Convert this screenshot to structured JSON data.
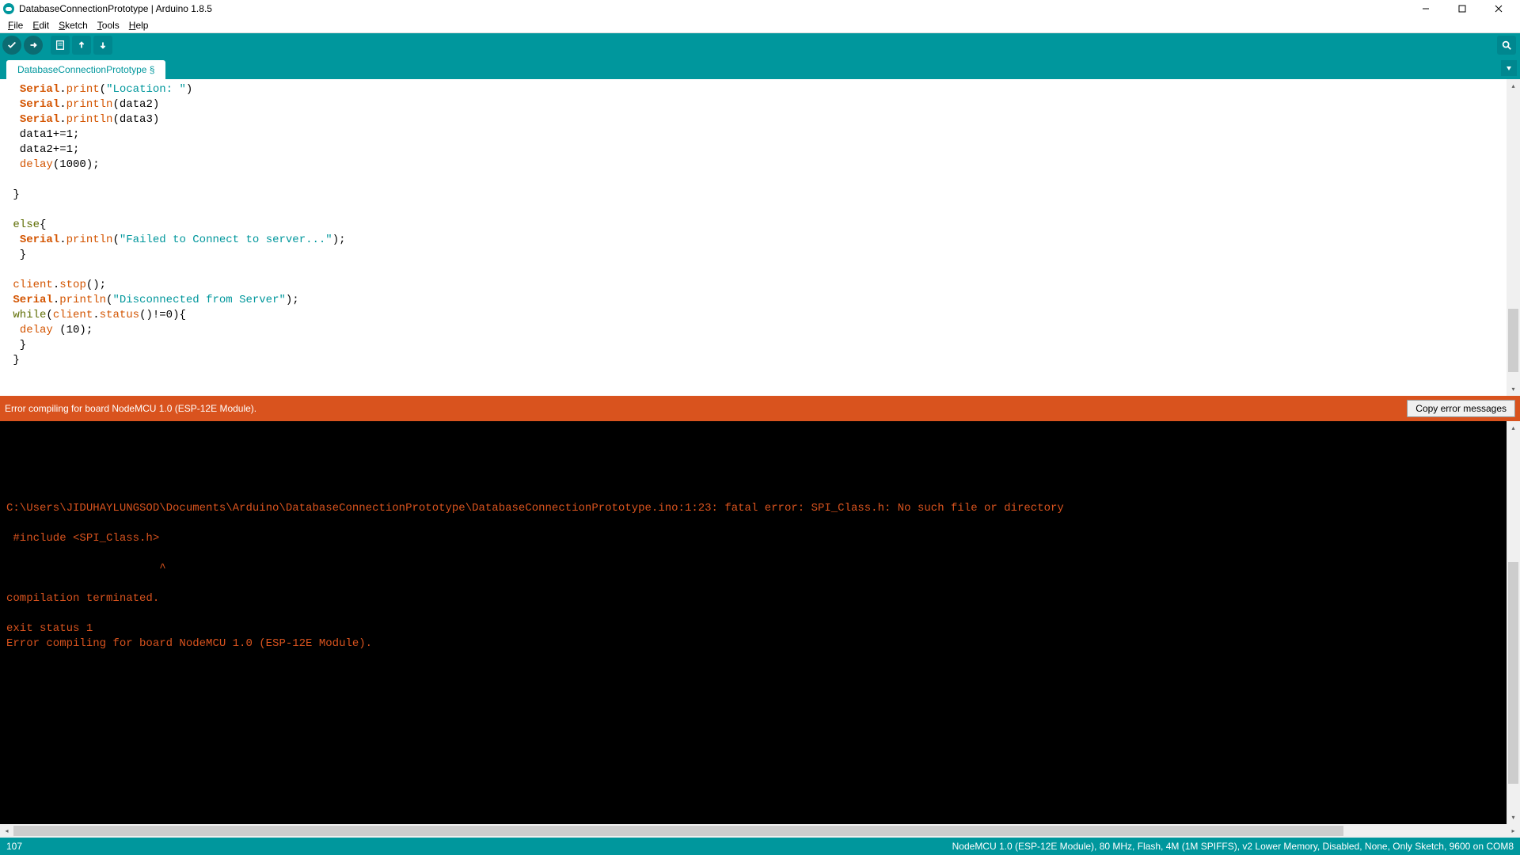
{
  "window": {
    "title": "DatabaseConnectionPrototype | Arduino 1.8.5"
  },
  "menu": {
    "file": "File",
    "edit": "Edit",
    "sketch": "Sketch",
    "tools": "Tools",
    "help": "Help"
  },
  "tab": {
    "name": "DatabaseConnectionPrototype §"
  },
  "code": {
    "tokens": [
      [
        {
          "t": "  ",
          "c": "plain"
        },
        {
          "t": "Serial",
          "c": "kw-orange"
        },
        {
          "t": ".",
          "c": "plain"
        },
        {
          "t": "print",
          "c": "kw-orange-light"
        },
        {
          "t": "(",
          "c": "plain"
        },
        {
          "t": "\"Location: \"",
          "c": "str"
        },
        {
          "t": ")",
          "c": "plain"
        }
      ],
      [
        {
          "t": "  ",
          "c": "plain"
        },
        {
          "t": "Serial",
          "c": "kw-orange"
        },
        {
          "t": ".",
          "c": "plain"
        },
        {
          "t": "println",
          "c": "kw-orange-light"
        },
        {
          "t": "(data2)",
          "c": "plain"
        }
      ],
      [
        {
          "t": "  ",
          "c": "plain"
        },
        {
          "t": "Serial",
          "c": "kw-orange"
        },
        {
          "t": ".",
          "c": "plain"
        },
        {
          "t": "println",
          "c": "kw-orange-light"
        },
        {
          "t": "(data3)",
          "c": "plain"
        }
      ],
      [
        {
          "t": "  data1+=1;",
          "c": "plain"
        }
      ],
      [
        {
          "t": "  data2+=1;",
          "c": "plain"
        }
      ],
      [
        {
          "t": "  ",
          "c": "plain"
        },
        {
          "t": "delay",
          "c": "kw-orange-light"
        },
        {
          "t": "(1000);",
          "c": "plain"
        }
      ],
      [
        {
          "t": " ",
          "c": "plain"
        }
      ],
      [
        {
          "t": " }",
          "c": "plain"
        }
      ],
      [
        {
          "t": " ",
          "c": "plain"
        }
      ],
      [
        {
          "t": " ",
          "c": "plain"
        },
        {
          "t": "else",
          "c": "kw-green"
        },
        {
          "t": "{",
          "c": "plain"
        }
      ],
      [
        {
          "t": "  ",
          "c": "plain"
        },
        {
          "t": "Serial",
          "c": "kw-orange"
        },
        {
          "t": ".",
          "c": "plain"
        },
        {
          "t": "println",
          "c": "kw-orange-light"
        },
        {
          "t": "(",
          "c": "plain"
        },
        {
          "t": "\"Failed to Connect to server...\"",
          "c": "str"
        },
        {
          "t": ");",
          "c": "plain"
        }
      ],
      [
        {
          "t": "  }",
          "c": "plain"
        }
      ],
      [
        {
          "t": " ",
          "c": "plain"
        }
      ],
      [
        {
          "t": " ",
          "c": "plain"
        },
        {
          "t": "client",
          "c": "kw-orange-light"
        },
        {
          "t": ".",
          "c": "plain"
        },
        {
          "t": "stop",
          "c": "kw-orange-light"
        },
        {
          "t": "();",
          "c": "plain"
        }
      ],
      [
        {
          "t": " ",
          "c": "plain"
        },
        {
          "t": "Serial",
          "c": "kw-orange"
        },
        {
          "t": ".",
          "c": "plain"
        },
        {
          "t": "println",
          "c": "kw-orange-light"
        },
        {
          "t": "(",
          "c": "plain"
        },
        {
          "t": "\"Disconnected from Server\"",
          "c": "str"
        },
        {
          "t": ");",
          "c": "plain"
        }
      ],
      [
        {
          "t": " ",
          "c": "plain"
        },
        {
          "t": "while",
          "c": "kw-green"
        },
        {
          "t": "(",
          "c": "plain"
        },
        {
          "t": "client",
          "c": "kw-orange-light"
        },
        {
          "t": ".",
          "c": "plain"
        },
        {
          "t": "status",
          "c": "kw-orange-light"
        },
        {
          "t": "()!=0){",
          "c": "plain"
        }
      ],
      [
        {
          "t": "  ",
          "c": "plain"
        },
        {
          "t": "delay",
          "c": "kw-orange-light"
        },
        {
          "t": " (10);",
          "c": "plain"
        }
      ],
      [
        {
          "t": "  }",
          "c": "plain"
        }
      ],
      [
        {
          "t": " }",
          "c": "plain"
        }
      ]
    ]
  },
  "status": {
    "message": "Error compiling for board NodeMCU 1.0 (ESP-12E Module).",
    "copy_button": "Copy error messages"
  },
  "console": {
    "lines": [
      "",
      "",
      "",
      "",
      "",
      "C:\\Users\\JIDUHAYLUNGSOD\\Documents\\Arduino\\DatabaseConnectionPrototype\\DatabaseConnectionPrototype.ino:1:23: fatal error: SPI_Class.h: No such file or directory",
      "",
      " #include <SPI_Class.h>",
      "",
      "                       ^",
      "",
      "compilation terminated.",
      "",
      "exit status 1",
      "Error compiling for board NodeMCU 1.0 (ESP-12E Module)."
    ]
  },
  "footer": {
    "line_number": "107",
    "board_info": "NodeMCU 1.0 (ESP-12E Module), 80 MHz, Flash, 4M (1M SPIFFS), v2 Lower Memory, Disabled, None, Only Sketch, 9600 on COM8"
  }
}
